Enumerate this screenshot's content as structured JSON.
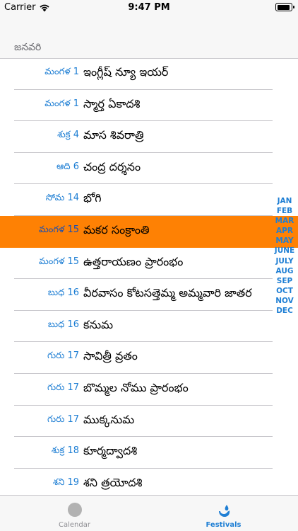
{
  "status_bar": {
    "carrier": "Carrier",
    "time": "9:47 PM"
  },
  "section": {
    "month": "జనవరి"
  },
  "festivals": [
    {
      "day": "మంగళ 1",
      "name": "ఇంగ్లీష్ న్యూ ఇయర్"
    },
    {
      "day": "మంగళ 1",
      "name": "స్మార్త ఏకాదశి"
    },
    {
      "day": "శుక్ర 4",
      "name": "మాస శివరాత్రి"
    },
    {
      "day": "ఆది 6",
      "name": "చంద్ర దర్శనం"
    },
    {
      "day": "సోమ 14",
      "name": "భోగి"
    },
    {
      "day": "మంగళ 15",
      "name": "మకర సంక్రాంతి"
    },
    {
      "day": "మంగళ 15",
      "name": "ఉత్తరాయణం ప్రారంభం"
    },
    {
      "day": "బుధ 16",
      "name": "వీరవాసం కోటసత్తెమ్మ అమ్మవారి జాతర"
    },
    {
      "day": "బుధ 16",
      "name": "కనుమ"
    },
    {
      "day": "గురు 17",
      "name": "సావిత్రీ వ్రతం"
    },
    {
      "day": "గురు 17",
      "name": "బొమ్మల నోము  ప్రారంభం"
    },
    {
      "day": "గురు 17",
      "name": "ముక్కనుమ"
    },
    {
      "day": "శుక్ర 18",
      "name": "కూర్మద్వాదశి"
    },
    {
      "day": "శని 19",
      "name": "శని త్రయోదశి"
    }
  ],
  "highlighted_index": 5,
  "month_index": [
    "JAN",
    "FEB",
    "MAR",
    "APR",
    "MAY",
    "JUNE",
    "JULY",
    "AUG",
    "SEP",
    "OCT",
    "NOV",
    "DEC"
  ],
  "tabs": [
    {
      "label": "Calendar",
      "icon": "calendar-circle-icon",
      "selected": false
    },
    {
      "label": "Festivals",
      "icon": "water-drop-icon",
      "selected": true
    }
  ],
  "colors": {
    "accent": "#1f7fd4",
    "highlight": "#fe8104"
  }
}
